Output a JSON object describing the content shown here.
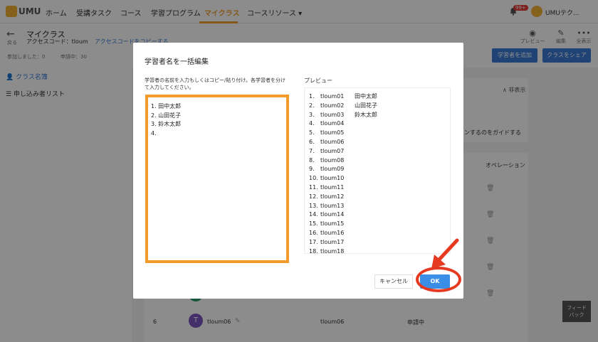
{
  "nav": {
    "logo_text": "UMU",
    "items": [
      "ホーム",
      "受講タスク",
      "コース",
      "学習プログラム",
      "マイクラス",
      "コースリソース ▾"
    ],
    "badge": "99+",
    "user_name": "UMUテク..."
  },
  "header": {
    "back_label": "戻る",
    "title": "マイクラス",
    "access_code": "アクセスコード：tloum",
    "copy_link": "アクセスコードをコピーする",
    "stat_joined": "参加しました：0",
    "stat_applying": "申請中：30",
    "tools": [
      {
        "icon": "eye-icon",
        "glyph": "◉",
        "label": "プレビュー"
      },
      {
        "icon": "edit-icon",
        "glyph": "✎",
        "label": "編集"
      },
      {
        "icon": "more-icon",
        "glyph": "•••",
        "label": "全表示"
      }
    ],
    "add_learner_button": "学習者を追加",
    "share_button": "クラスをシェア"
  },
  "sidebar": {
    "items": [
      {
        "label": "クラス名簿",
        "active": true
      },
      {
        "label": "申し込み者リスト",
        "active": false
      }
    ]
  },
  "main": {
    "hide_link": "∧ 非表示",
    "guide_text": "ンするのをガイドする",
    "operation_header": "オペレーション",
    "row": {
      "num": "6",
      "avatar": "T",
      "name": "tloum06",
      "id": "tloum06",
      "status": "申請中"
    }
  },
  "feedback": {
    "line1": "フィード",
    "line2": "バック"
  },
  "modal": {
    "title": "学習者名を一括編集",
    "instruction": "学習者の名前を入力もしくはコピー/貼り付け。各学習者を分けて入力してください。",
    "textarea_lines": [
      "1.   田中太郎",
      "2.   山田花子",
      "3.   鈴木太郎",
      "4."
    ],
    "preview_label": "プレビュー",
    "preview_rows": [
      {
        "num": "1.",
        "id": "tloum01",
        "name": "田中太郎"
      },
      {
        "num": "2.",
        "id": "tloum02",
        "name": "山田花子"
      },
      {
        "num": "3.",
        "id": "tloum03",
        "name": "鈴木太郎"
      },
      {
        "num": "4.",
        "id": "tloum04",
        "name": ""
      },
      {
        "num": "5.",
        "id": "tloum05",
        "name": ""
      },
      {
        "num": "6.",
        "id": "tloum06",
        "name": ""
      },
      {
        "num": "7.",
        "id": "tloum07",
        "name": ""
      },
      {
        "num": "8.",
        "id": "tloum08",
        "name": ""
      },
      {
        "num": "9.",
        "id": "tloum09",
        "name": ""
      },
      {
        "num": "10.",
        "id": "tloum10",
        "name": ""
      },
      {
        "num": "11.",
        "id": "tloum11",
        "name": ""
      },
      {
        "num": "12.",
        "id": "tloum12",
        "name": ""
      },
      {
        "num": "13.",
        "id": "tloum13",
        "name": ""
      },
      {
        "num": "14.",
        "id": "tloum14",
        "name": ""
      },
      {
        "num": "15.",
        "id": "tloum15",
        "name": ""
      },
      {
        "num": "16.",
        "id": "tloum16",
        "name": ""
      },
      {
        "num": "17.",
        "id": "tloum17",
        "name": ""
      },
      {
        "num": "18.",
        "id": "tloum18",
        "name": ""
      }
    ],
    "cancel_button": "キャンセル",
    "ok_button": "OK"
  },
  "colors": {
    "accent": "#f2a033",
    "primary": "#3a7bd5",
    "highlight_border": "#f39a2d",
    "annotation_red": "#e53920"
  }
}
